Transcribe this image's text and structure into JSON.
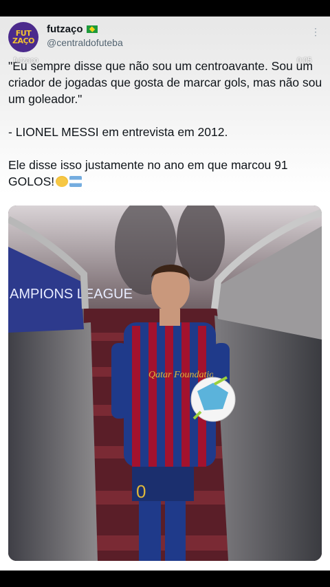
{
  "header": {
    "avatar_text": "FUT ZAÇO",
    "display_name": "futzaço",
    "handle": "@centraldofuteba",
    "more_glyph": "⋮"
  },
  "overlay": {
    "left": "futzaço",
    "right": "0:05"
  },
  "tweet": {
    "quote": "\"Eu sempre disse que não sou um centroavante. Sou um criador de jogadas que gosta de marcar gols, mas não sou um goleador.\"",
    "attribution": "- LIONEL MESSI em entrevista em 2012.",
    "comment": "Ele disse isso justamente no ano em que marcou 91 GOLOS!"
  },
  "photo": {
    "banner_text": "AMPIONS LEAGUE",
    "shirt_text": "Qatar Foundation",
    "shorts_number": "0"
  },
  "colors": {
    "avatar_bg": "#4b2a8c",
    "avatar_fg": "#f2c230",
    "handle": "#536471",
    "blaugrana_blue": "#1f3a8a",
    "blaugrana_red": "#a3122e"
  }
}
